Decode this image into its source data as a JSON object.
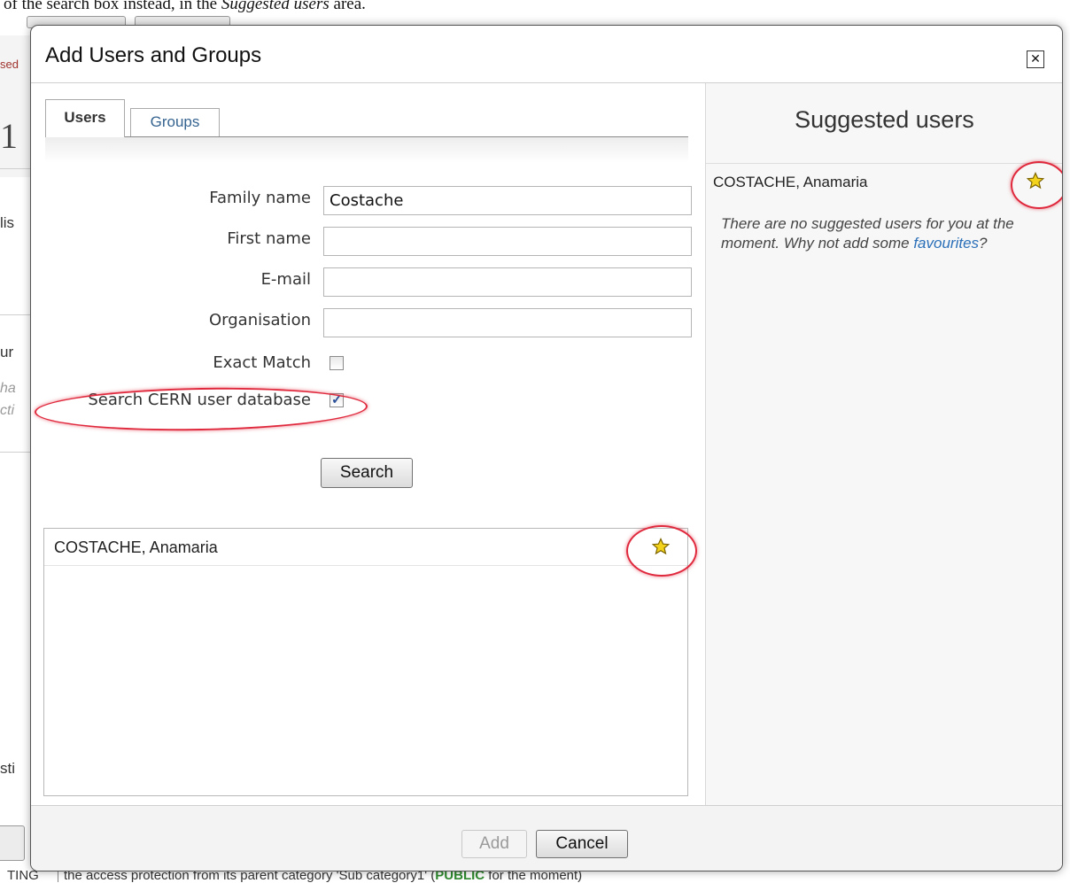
{
  "background": {
    "top_text_plain": "of the search box instead, in the",
    "top_text_italic": "Suggested users",
    "top_text_end": "area.",
    "frag_red": "sed",
    "frag_big": "1",
    "frag_lis": "lis",
    "frag_ur": "ur",
    "frag_ha": "ha",
    "frag_cti": "cti",
    "frag_sti": "sti",
    "bottom_cell1": "TING",
    "bottom_cell2_before": "the access protection from its parent category 'Sub category1' (",
    "bottom_cell2_bold": "PUBLIC",
    "bottom_cell2_after": " for the moment)"
  },
  "dialog": {
    "title": "Add Users and Groups",
    "close_glyph": "✕"
  },
  "tabs": [
    {
      "label": "Users",
      "active": true
    },
    {
      "label": "Groups",
      "active": false
    }
  ],
  "form": {
    "family_name_label": "Family name",
    "family_name_value": "Costache",
    "first_name_label": "First name",
    "first_name_value": "",
    "email_label": "E-mail",
    "email_value": "",
    "organisation_label": "Organisation",
    "organisation_value": "",
    "exact_match_label": "Exact Match",
    "exact_match_checked": false,
    "search_cern_label": "Search CERN user database",
    "search_cern_checked": true,
    "check_glyph": "✓",
    "search_button": "Search"
  },
  "results": {
    "items": [
      {
        "name": "COSTACHE, Anamaria",
        "icon": "star-icon"
      }
    ]
  },
  "suggested": {
    "title": "Suggested users",
    "items": [
      {
        "name": "COSTACHE, Anamaria",
        "icon": "star-icon"
      }
    ],
    "note_text": "There are no suggested users for you at the moment. Why not add some ",
    "note_link": "favourites",
    "note_end": "?"
  },
  "footer": {
    "add_button": "Add",
    "add_disabled": true,
    "cancel_button": "Cancel"
  },
  "colors": {
    "star_fill": "#f2d21b",
    "star_stroke": "#7d6400",
    "annotation": "#e0283c",
    "link": "#2a6fb8"
  }
}
